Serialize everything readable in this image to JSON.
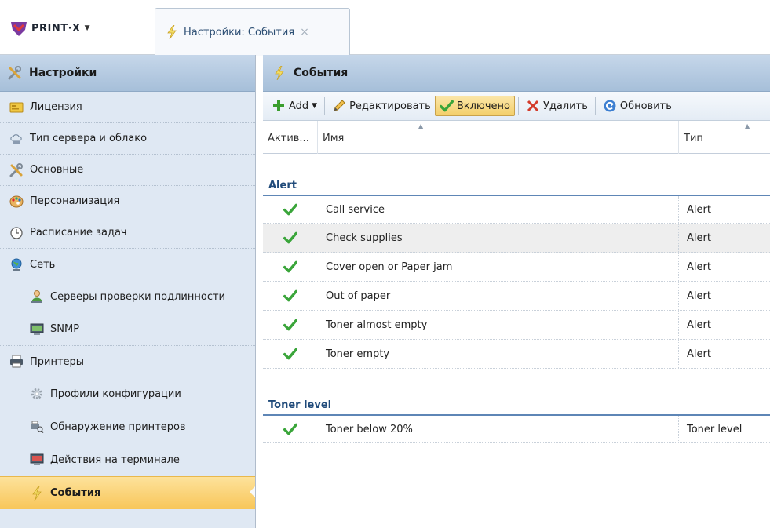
{
  "app": {
    "logo_text": "PRINT·X",
    "tab_label": "Настройки: События",
    "tab_close": "×"
  },
  "sidebar": {
    "title": "Настройки",
    "items": [
      {
        "label": "Лицензия",
        "icon": "license-icon"
      },
      {
        "label": "Тип сервера и облако",
        "icon": "cloud-server-icon"
      },
      {
        "label": "Основные",
        "icon": "tools-icon"
      },
      {
        "label": "Персонализация",
        "icon": "palette-icon"
      },
      {
        "label": "Расписание задач",
        "icon": "clock-icon"
      },
      {
        "label": "Сеть",
        "icon": "globe-icon"
      },
      {
        "label": "Серверы проверки подлинности",
        "icon": "user-server-icon"
      },
      {
        "label": "SNMP",
        "icon": "monitor-icon"
      },
      {
        "label": "Принтеры",
        "icon": "printer-icon"
      },
      {
        "label": "Профили конфигурации",
        "icon": "gear-icon"
      },
      {
        "label": "Обнаружение принтеров",
        "icon": "printer-search-icon"
      },
      {
        "label": "Действия на терминале",
        "icon": "terminal-icon"
      },
      {
        "label": "События",
        "icon": "lightning-icon"
      }
    ]
  },
  "main": {
    "title": "События",
    "toolbar": {
      "add": "Add",
      "edit": "Редактировать",
      "enabled": "Включено",
      "delete": "Удалить",
      "refresh": "Обновить"
    },
    "columns": {
      "active": "Актив...",
      "name": "Имя",
      "type": "Тип"
    },
    "groups": [
      {
        "name": "Alert",
        "rows": [
          {
            "name": "Call service",
            "type": "Alert"
          },
          {
            "name": "Check supplies",
            "type": "Alert"
          },
          {
            "name": "Cover open or Paper jam",
            "type": "Alert"
          },
          {
            "name": "Out of paper",
            "type": "Alert"
          },
          {
            "name": "Toner almost empty",
            "type": "Alert"
          },
          {
            "name": "Toner empty",
            "type": "Alert"
          }
        ]
      },
      {
        "name": "Toner level",
        "rows": [
          {
            "name": "Toner below 20%",
            "type": "Toner level"
          }
        ]
      }
    ]
  },
  "colors": {
    "accent_blue": "#1f4a7a",
    "active_item": "#f8c659",
    "check_green": "#3aa53a"
  }
}
